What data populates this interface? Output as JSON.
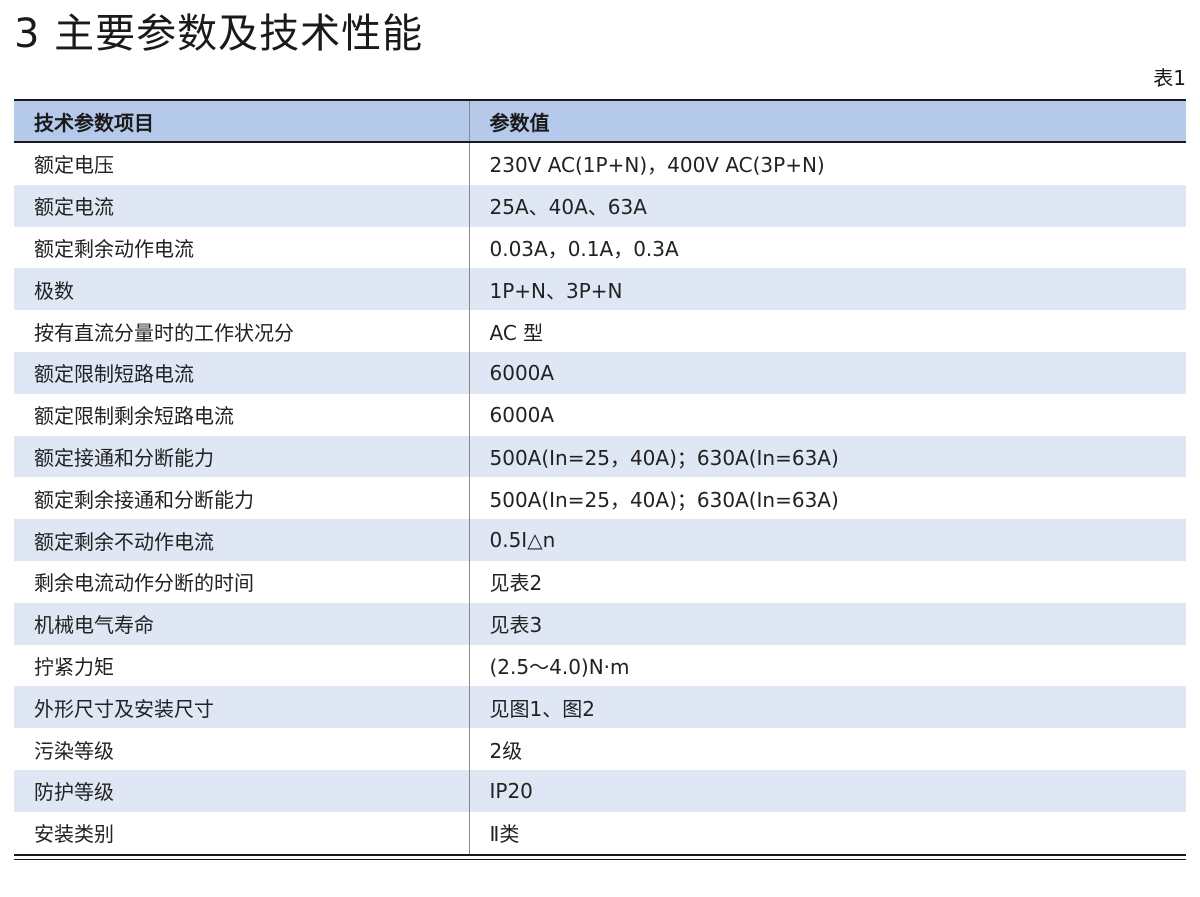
{
  "page": {
    "title": "3 主要参数及技术性能",
    "table_label": "表1"
  },
  "table": {
    "headers": [
      "技术参数项目",
      "参数值"
    ],
    "rows": [
      [
        "额定电压",
        "230V AC(1P+N)，400V AC(3P+N)"
      ],
      [
        "额定电流",
        "25A、40A、63A"
      ],
      [
        "额定剩余动作电流",
        "0.03A，0.1A，0.3A"
      ],
      [
        "极数",
        "1P+N、3P+N"
      ],
      [
        "按有直流分量时的工作状况分",
        "AC 型"
      ],
      [
        "额定限制短路电流",
        "6000A"
      ],
      [
        "额定限制剩余短路电流",
        "6000A"
      ],
      [
        "额定接通和分断能力",
        "500A(In=25，40A)；630A(In=63A)"
      ],
      [
        "额定剩余接通和分断能力",
        "500A(In=25，40A)；630A(In=63A)"
      ],
      [
        "额定剩余不动作电流",
        "0.5I△n"
      ],
      [
        "剩余电流动作分断的时间",
        "见表2"
      ],
      [
        "机械电气寿命",
        "见表3"
      ],
      [
        "拧紧力矩",
        "(2.5～4.0)N·m"
      ],
      [
        "外形尺寸及安装尺寸",
        "见图1、图2"
      ],
      [
        "污染等级",
        "2级"
      ],
      [
        "防护等级",
        "IP20"
      ],
      [
        "安装类别",
        "Ⅱ类"
      ]
    ]
  },
  "colors": {
    "header_bg": "#b5c9ea",
    "stripe_bg": "#dfe7f5",
    "rule": "#1a1a1a"
  }
}
